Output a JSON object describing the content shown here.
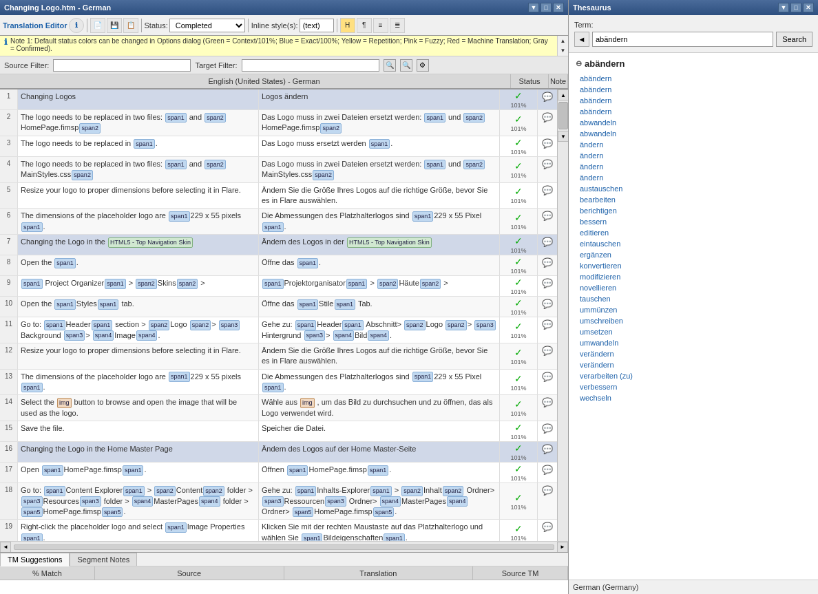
{
  "leftPanel": {
    "titleBar": {
      "title": "Changing Logo.htm - German",
      "controls": [
        "▼",
        "□",
        "✕"
      ]
    },
    "toolbar": {
      "translationEditorLabel": "Translation Editor",
      "statusLabel": "Status:",
      "statusValue": "Completed",
      "inlineStyleLabel": "Inline style(s):",
      "inlineStyleValue": "(text)"
    },
    "infoBar": {
      "text": "Note 1: Default status colors can be changed in Options dialog (Green = Context/101%; Blue = Exact/100%; Yellow = Repetition; Pink = Fuzzy; Red = Machine Translation; Gray = Confirmed)."
    },
    "filterBar": {
      "sourceFilterLabel": "Source Filter:",
      "targetFilterLabel": "Target Filter:"
    },
    "columnHeader": {
      "lang": "English (United States) - German",
      "status": "Status",
      "note": "Note"
    },
    "rows": [
      {
        "num": "1",
        "source": "Changing Logos",
        "target": "Logos ändern",
        "status": "✓",
        "pct": "101%",
        "isHeader": true
      },
      {
        "num": "2",
        "source": "The logo needs to be replaced in two files: [span1] and [span2] HomePage.fimsp[span2e]",
        "target": "Das Logo muss in zwei Dateien ersetzt werden: [span1] und [span2] HomePage.fimsp[span2e]",
        "status": "✓",
        "pct": "101%",
        "sourceHasTags": true,
        "targetHasTags": true
      },
      {
        "num": "3",
        "source": "The logo needs to be replaced in [span1].",
        "target": "Das Logo muss ersetzt werden [span1].",
        "status": "✓",
        "pct": "101%"
      },
      {
        "num": "4",
        "source": "The logo needs to be replaced in two files: [span1] and [span2] MainStyles.css[span2e]",
        "target": "Das Logo muss in zwei Dateien ersetzt werden: [span1] und [span2] MainStyles.css[span2e]",
        "status": "✓",
        "pct": "101%"
      },
      {
        "num": "5",
        "source": "Resize your logo to proper dimensions before selecting it in Flare.",
        "target": "Ändern Sie die Größe Ihres Logos auf die richtige Größe, bevor Sie es in Flare auswählen.",
        "status": "✓",
        "pct": "101%"
      },
      {
        "num": "6",
        "source": "The dimensions of the placeholder logo are [span1]229 x 55 pixels[span1e].",
        "target": "Die Abmessungen des Platzhalterlogos sind [span1]229 x 55 Pixel[span1e].",
        "status": "✓",
        "pct": "101%"
      },
      {
        "num": "7",
        "source": "Changing the Logo in the [HTML5 - Top Navigation Skin]",
        "target": "Ändern des Logos in der [HTML5 - Top Navigation Skin]",
        "status": "✓",
        "pct": "101%",
        "isHeader": true
      },
      {
        "num": "8",
        "source": "Open the [span1].",
        "target": "Öffne das [span1].",
        "status": "✓",
        "pct": "101%"
      },
      {
        "num": "9",
        "source": "[span1] Project Organizer[span1e] > [span2]Skins[span2e] >",
        "target": "[span1]Projektorganisator[span1e] > [span2]Häute[span2e] >",
        "status": "✓",
        "pct": "101%"
      },
      {
        "num": "10",
        "source": "Open the [span1]Styles[span1e] tab.",
        "target": "Öffne das [span1]Stile[span1e] Tab.",
        "status": "✓",
        "pct": "101%"
      },
      {
        "num": "11",
        "source": "Go to: [span1]Header[span1e] section > [span2]Logo [span2e]> [span3]Background [span3e]> [span4]Image[span4e].",
        "target": "Gehe zu: [span1]Header[span1e] Abschnitt> [span2]Logo [span2e]> [span3]Hintergrund [span3e]> [span4]Bild[span4e].",
        "status": "✓",
        "pct": "101%"
      },
      {
        "num": "12",
        "source": "Resize your logo to proper dimensions before selecting it in Flare.",
        "target": "Ändern Sie die Größe Ihres Logos auf die richtige Größe, bevor Sie es in Flare auswählen.",
        "status": "✓",
        "pct": "101%"
      },
      {
        "num": "13",
        "source": "The dimensions of the placeholder logo are [span1]229 x 55 pixels[span1e].",
        "target": "Die Abmessungen des Platzhalterlogos sind [span1]229 x 55 Pixel[span1e].",
        "status": "✓",
        "pct": "101%"
      },
      {
        "num": "14",
        "source": "Select the [img] button to browse and open the image that will be used as the logo.",
        "target": "Wähle aus [img] , um das Bild zu durchsuchen und zu öffnen, das als Logo verwendet wird.",
        "status": "✓",
        "pct": "101%"
      },
      {
        "num": "15",
        "source": "Save the file.",
        "target": "Speicher die Datei.",
        "status": "✓",
        "pct": "101%"
      },
      {
        "num": "16",
        "source": "Changing the Logo in the Home Master Page",
        "target": "Ändern des Logos auf der Home Master-Seite",
        "status": "✓",
        "pct": "101%",
        "isHeader": true
      },
      {
        "num": "17",
        "source": "Open [span1]HomePage.fimsp[span1e].",
        "target": "Öffnen [span1]HomePage.fimsp[span1e].",
        "status": "✓",
        "pct": "101%"
      },
      {
        "num": "18",
        "source": "Go to: [span1]Content Explorer[span1e] > [span2]Content[span2e] folder > [span3]Resources[span3e] folder > [span4]MasterPages[span4e] folder > [span5]HomePage.fimsp[span5e].",
        "target": "Gehe zu: [span1]Inhalts-Explorer[span1e] > [span2]Inhalt[span2e] Ordner> [span3]Ressourcen[span3e] Ordner> [span4]MasterPages[span4e] Ordner> [span5]HomePage.fimsp[span5e].",
        "status": "✓",
        "pct": "101%"
      },
      {
        "num": "19",
        "source": "Right-click the placeholder logo and select [span1]Image Properties[span1e].",
        "target": "Klicken Sie mit der rechten Maustaste auf das Platzhalterlogo und wählen Sie [span1]Bildeigenschaften[span1e].",
        "status": "✓",
        "pct": "101%"
      }
    ],
    "bottomTabs": [
      "TM Suggestions",
      "Segment Notes"
    ],
    "bottomColumns": [
      {
        "label": "% Match",
        "flex": 1
      },
      {
        "label": "Source",
        "flex": 2
      },
      {
        "label": "Translation",
        "flex": 2
      },
      {
        "label": "Source TM",
        "flex": 1
      }
    ]
  },
  "rightPanel": {
    "titleBar": {
      "title": "Thesaurus",
      "controls": [
        "▼",
        "□",
        "✕"
      ]
    },
    "termLabel": "Term:",
    "searchValue": "abändern",
    "searchButtonLabel": "Search",
    "mainWord": "abändern",
    "synonyms": [
      "abändern",
      "abändern",
      "abändern",
      "abändern",
      "abwandeln",
      "abwandeln",
      "ändern",
      "ändern",
      "ändern",
      "ändern",
      "austauschen",
      "bearbeiten",
      "berichtigen",
      "bessern",
      "editieren",
      "eintauschen",
      "ergänzen",
      "konvertieren",
      "modifizieren",
      "novellieren",
      "tauschen",
      "ummünzen",
      "umschreiben",
      "umsetzen",
      "umwandeln",
      "verändern",
      "verändern",
      "verarbeiten (zu)",
      "verbessern",
      "wechseln"
    ],
    "footer": "German (Germany)"
  }
}
